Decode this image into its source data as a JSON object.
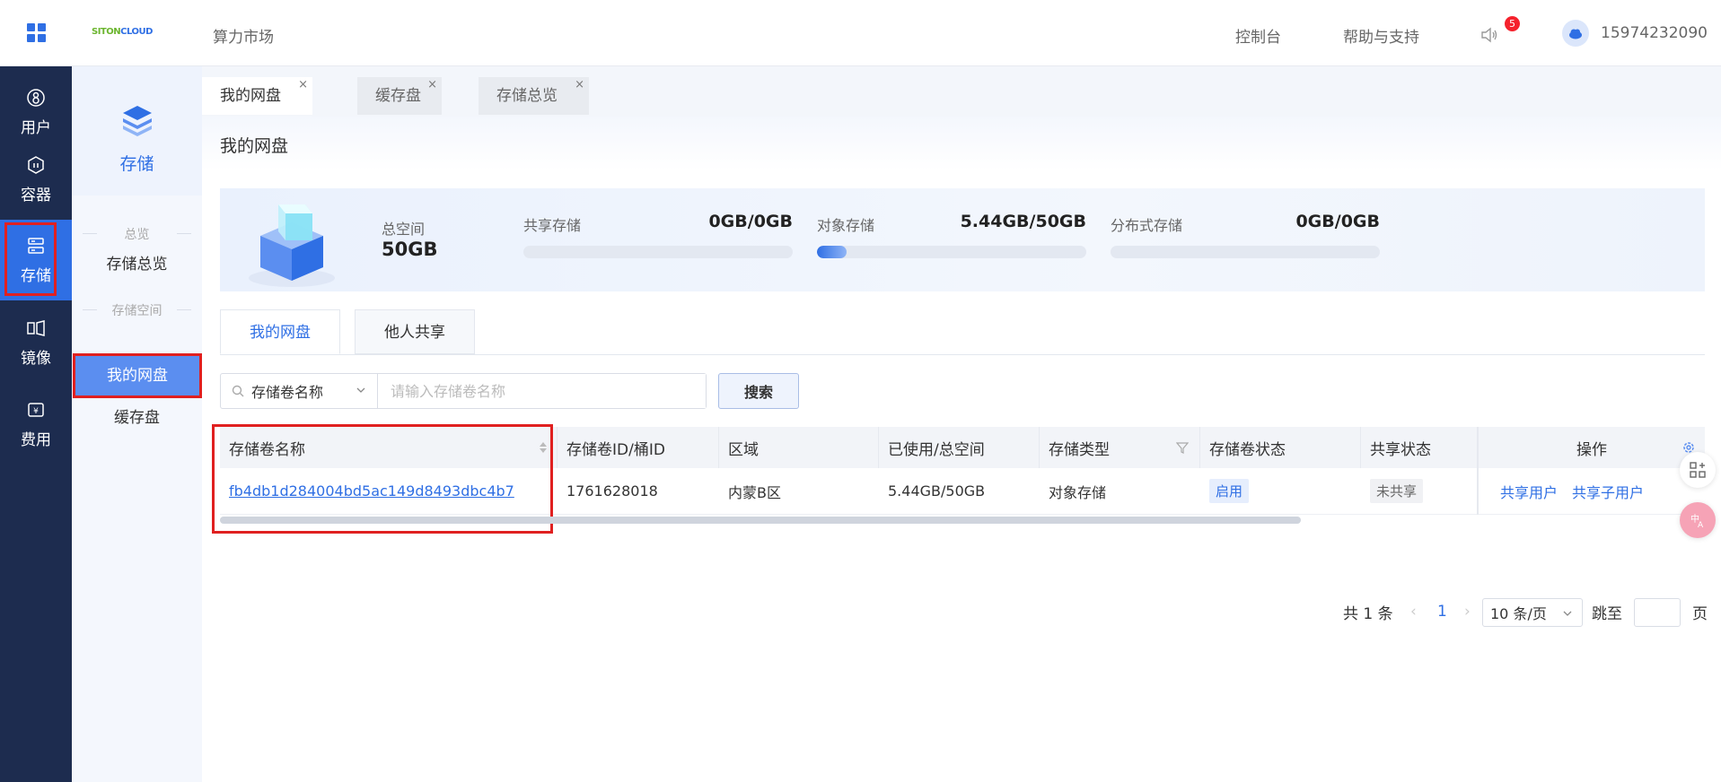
{
  "header": {
    "brand_a": "SITON",
    "brand_b": "CLOUD",
    "market": "算力市场",
    "console": "控制台",
    "help": "帮助与支持",
    "badge_count": "5",
    "user": "15974232090"
  },
  "leftnav": {
    "items": [
      {
        "label": "用户",
        "icon": "user-icon"
      },
      {
        "label": "容器",
        "icon": "container-icon"
      },
      {
        "label": "存储",
        "icon": "storage-icon"
      },
      {
        "label": "镜像",
        "icon": "image-icon"
      },
      {
        "label": "费用",
        "icon": "billing-icon"
      }
    ],
    "active": "存储"
  },
  "subnav": {
    "title": "存储",
    "group1": "总览",
    "item_overview": "存储总览",
    "group2": "存储空间",
    "item_mydisk": "我的网盘",
    "item_cache": "缓存盘"
  },
  "page_tabs": [
    {
      "label": "我的网盘",
      "active": true
    },
    {
      "label": "缓存盘",
      "active": false
    },
    {
      "label": "存储总览",
      "active": false
    }
  ],
  "page_title": "我的网盘",
  "summary": {
    "total_label": "总空间",
    "total_value": "50GB",
    "meters": [
      {
        "label": "共享存储",
        "value": "0GB/0GB",
        "fraction": 0
      },
      {
        "label": "对象存储",
        "value": "5.44GB/50GB",
        "fraction": 0.1088
      },
      {
        "label": "分布式存储",
        "value": "0GB/0GB",
        "fraction": 0
      }
    ]
  },
  "inner_tabs": [
    {
      "label": "我的网盘",
      "active": true
    },
    {
      "label": "他人共享",
      "active": false
    }
  ],
  "search": {
    "field_select": "存储卷名称",
    "placeholder": "请输入存储卷名称",
    "button": "搜索"
  },
  "table": {
    "columns": [
      "存储卷名称",
      "存储卷ID/桶ID",
      "区域",
      "已使用/总空间",
      "存储类型",
      "存储卷状态",
      "共享状态",
      "操作"
    ],
    "rows": [
      {
        "name": "fb4db1d284004bd5ac149d8493dbc4b7",
        "id": "1761628018",
        "region": "内蒙B区",
        "usage": "5.44GB/50GB",
        "type": "对象存储",
        "status": "启用",
        "share": "未共享",
        "op1": "共享用户",
        "op2": "共享子用户"
      }
    ]
  },
  "pagination": {
    "total": "共 1 条",
    "current": "1",
    "page_size": "10 条/页",
    "goto": "跳至",
    "page": "页"
  },
  "colors": {
    "accent": "#2f6fe4",
    "nav_bg": "#1d2c4f",
    "highlight": "#e02020"
  }
}
